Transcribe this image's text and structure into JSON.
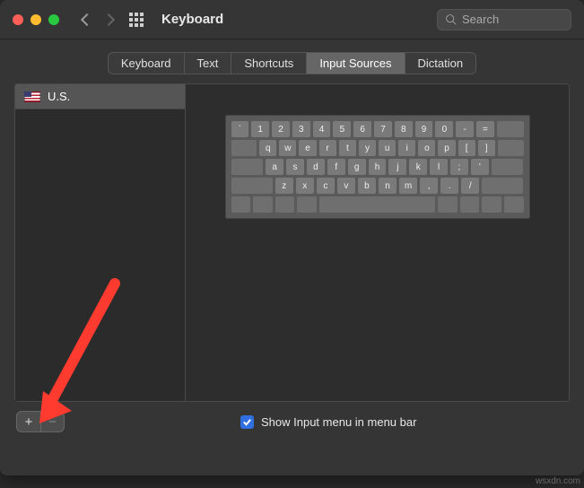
{
  "window": {
    "title": "Keyboard"
  },
  "search": {
    "placeholder": "Search"
  },
  "tabs": [
    "Keyboard",
    "Text",
    "Shortcuts",
    "Input Sources",
    "Dictation"
  ],
  "active_tab_index": 3,
  "sources": [
    {
      "flag": "us",
      "name": "U.S."
    }
  ],
  "keyboard_rows": [
    [
      "`",
      "1",
      "2",
      "3",
      "4",
      "5",
      "6",
      "7",
      "8",
      "9",
      "0",
      "-",
      "="
    ],
    [
      "q",
      "w",
      "e",
      "r",
      "t",
      "y",
      "u",
      "i",
      "o",
      "p",
      "[",
      "]"
    ],
    [
      "a",
      "s",
      "d",
      "f",
      "g",
      "h",
      "j",
      "k",
      "l",
      ";",
      "'"
    ],
    [
      "z",
      "x",
      "c",
      "v",
      "b",
      "n",
      "m",
      ",",
      ".",
      "/"
    ]
  ],
  "buttons": {
    "add": "+",
    "remove": "−"
  },
  "checkbox": {
    "label": "Show Input menu in menu bar",
    "checked": true
  },
  "watermark": "wsxdn.com"
}
